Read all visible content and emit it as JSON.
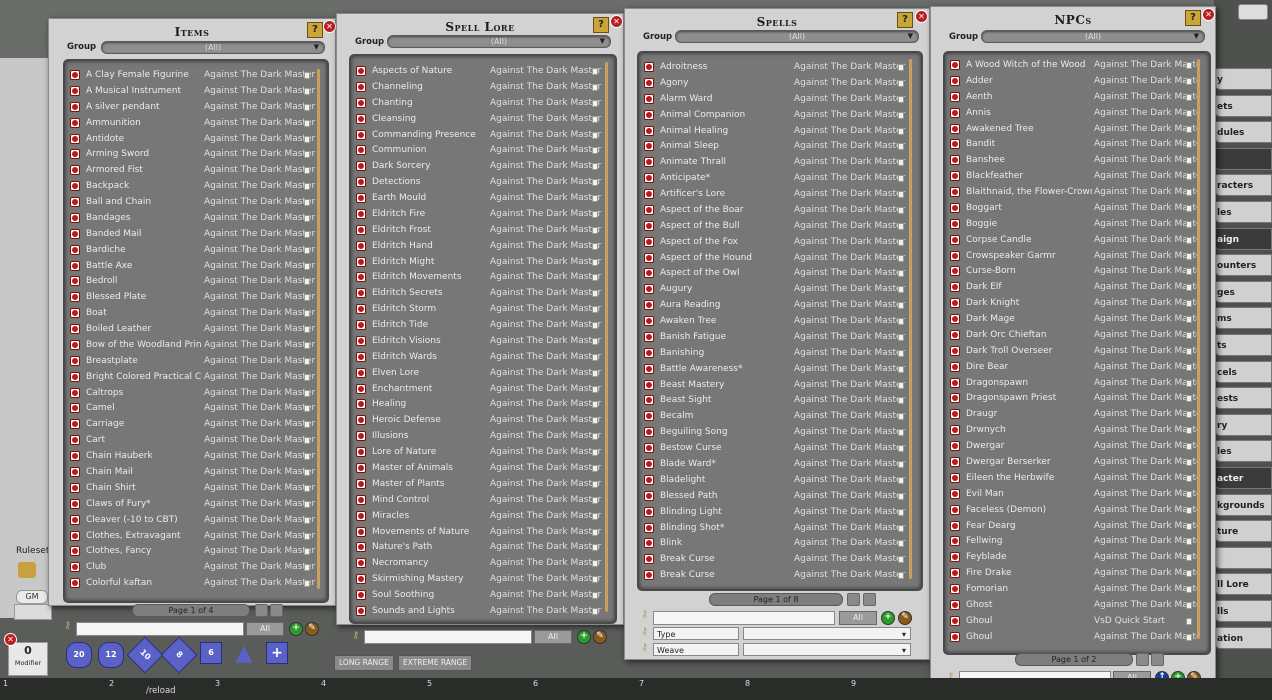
{
  "windows": {
    "items": {
      "title": "Items",
      "group_label": "Group",
      "group_value": "(All)",
      "rows": [
        [
          "A Clay Female Figurine",
          "Against The Dark Master"
        ],
        [
          "A Musical Instrument",
          "Against The Dark Master"
        ],
        [
          "A silver pendant",
          "Against The Dark Master"
        ],
        [
          "Ammunition",
          "Against The Dark Master"
        ],
        [
          "Antidote",
          "Against The Dark Master"
        ],
        [
          "Arming Sword",
          "Against The Dark Master"
        ],
        [
          "Armored Fist",
          "Against The Dark Master"
        ],
        [
          "Backpack",
          "Against The Dark Master"
        ],
        [
          "Ball and Chain",
          "Against The Dark Master"
        ],
        [
          "Bandages",
          "Against The Dark Master"
        ],
        [
          "Banded Mail",
          "Against The Dark Master"
        ],
        [
          "Bardiche",
          "Against The Dark Master"
        ],
        [
          "Battle Axe",
          "Against The Dark Master"
        ],
        [
          "Bedroll",
          "Against The Dark Master"
        ],
        [
          "Blessed Plate",
          "Against The Dark Master"
        ],
        [
          "Boat",
          "Against The Dark Master"
        ],
        [
          "Boiled Leather",
          "Against The Dark Master"
        ],
        [
          "Bow of the Woodland Prince",
          "Against The Dark Master"
        ],
        [
          "Breastplate",
          "Against The Dark Master"
        ],
        [
          "Bright Colored Practical Clothing",
          "Against The Dark Master"
        ],
        [
          "Caltrops",
          "Against The Dark Master"
        ],
        [
          "Camel",
          "Against The Dark Master"
        ],
        [
          "Carriage",
          "Against The Dark Master"
        ],
        [
          "Cart",
          "Against The Dark Master"
        ],
        [
          "Chain Hauberk",
          "Against The Dark Master"
        ],
        [
          "Chain Mail",
          "Against The Dark Master"
        ],
        [
          "Chain Shirt",
          "Against The Dark Master"
        ],
        [
          "Claws of Fury*",
          "Against The Dark Master"
        ],
        [
          "Cleaver (-10 to CBT)",
          "Against The Dark Master"
        ],
        [
          "Clothes, Extravagant",
          "Against The Dark Master"
        ],
        [
          "Clothes, Fancy",
          "Against The Dark Master"
        ],
        [
          "Club",
          "Against The Dark Master"
        ],
        [
          "Colorful kaftan",
          "Against The Dark Master"
        ]
      ],
      "pager": "Page 1 of 4",
      "all_label": "All"
    },
    "spell_lore": {
      "title": "Spell Lore",
      "group_label": "Group",
      "group_value": "(All)",
      "rows": [
        [
          "Aspects of Nature",
          "Against The Dark Master"
        ],
        [
          "Channeling",
          "Against The Dark Master"
        ],
        [
          "Chanting",
          "Against The Dark Master"
        ],
        [
          "Cleansing",
          "Against The Dark Master"
        ],
        [
          "Commanding Presence",
          "Against The Dark Master"
        ],
        [
          "Communion",
          "Against The Dark Master"
        ],
        [
          "Dark Sorcery",
          "Against The Dark Master"
        ],
        [
          "Detections",
          "Against The Dark Master"
        ],
        [
          "Earth Mould",
          "Against The Dark Master"
        ],
        [
          "Eldritch Fire",
          "Against The Dark Master"
        ],
        [
          "Eldritch Frost",
          "Against The Dark Master"
        ],
        [
          "Eldritch Hand",
          "Against The Dark Master"
        ],
        [
          "Eldritch Might",
          "Against The Dark Master"
        ],
        [
          "Eldritch Movements",
          "Against The Dark Master"
        ],
        [
          "Eldritch Secrets",
          "Against The Dark Master"
        ],
        [
          "Eldritch Storm",
          "Against The Dark Master"
        ],
        [
          "Eldritch Tide",
          "Against The Dark Master"
        ],
        [
          "Eldritch Visions",
          "Against The Dark Master"
        ],
        [
          "Eldritch Wards",
          "Against The Dark Master"
        ],
        [
          "Elven Lore",
          "Against The Dark Master"
        ],
        [
          "Enchantment",
          "Against The Dark Master"
        ],
        [
          "Healing",
          "Against The Dark Master"
        ],
        [
          "Heroic Defense",
          "Against The Dark Master"
        ],
        [
          "Illusions",
          "Against The Dark Master"
        ],
        [
          "Lore of Nature",
          "Against The Dark Master"
        ],
        [
          "Master of Animals",
          "Against The Dark Master"
        ],
        [
          "Master of Plants",
          "Against The Dark Master"
        ],
        [
          "Mind Control",
          "Against The Dark Master"
        ],
        [
          "Miracles",
          "Against The Dark Master"
        ],
        [
          "Movements of Nature",
          "Against The Dark Master"
        ],
        [
          "Nature's Path",
          "Against The Dark Master"
        ],
        [
          "Necromancy",
          "Against The Dark Master"
        ],
        [
          "Skirmishing Mastery",
          "Against The Dark Master"
        ],
        [
          "Soul Soothing",
          "Against The Dark Master"
        ],
        [
          "Sounds and Lights",
          "Against The Dark Master"
        ]
      ],
      "all_label": "All"
    },
    "spells": {
      "title": "Spells",
      "group_label": "Group",
      "group_value": "(All)",
      "rows": [
        [
          "Adroitness",
          "Against The Dark Master"
        ],
        [
          "Agony",
          "Against The Dark Master"
        ],
        [
          "Alarm Ward",
          "Against The Dark Master"
        ],
        [
          "Animal Companion",
          "Against The Dark Master"
        ],
        [
          "Animal Healing",
          "Against The Dark Master"
        ],
        [
          "Animal Sleep",
          "Against The Dark Master"
        ],
        [
          "Animate Thrall",
          "Against The Dark Master"
        ],
        [
          "Anticipate*",
          "Against The Dark Master"
        ],
        [
          "Artificer's Lore",
          "Against The Dark Master"
        ],
        [
          "Aspect of the Boar",
          "Against The Dark Master"
        ],
        [
          "Aspect of the Bull",
          "Against The Dark Master"
        ],
        [
          "Aspect of the Fox",
          "Against The Dark Master"
        ],
        [
          "Aspect of the Hound",
          "Against The Dark Master"
        ],
        [
          "Aspect of the Owl",
          "Against The Dark Master"
        ],
        [
          "Augury",
          "Against The Dark Master"
        ],
        [
          "Aura Reading",
          "Against The Dark Master"
        ],
        [
          "Awaken Tree",
          "Against The Dark Master"
        ],
        [
          "Banish Fatigue",
          "Against The Dark Master"
        ],
        [
          "Banishing",
          "Against The Dark Master"
        ],
        [
          "Battle Awareness*",
          "Against The Dark Master"
        ],
        [
          "Beast Mastery",
          "Against The Dark Master"
        ],
        [
          "Beast Sight",
          "Against The Dark Master"
        ],
        [
          "Becalm",
          "Against The Dark Master"
        ],
        [
          "Beguiling Song",
          "Against The Dark Master"
        ],
        [
          "Bestow Curse",
          "Against The Dark Master"
        ],
        [
          "Blade Ward*",
          "Against The Dark Master"
        ],
        [
          "Bladelight",
          "Against The Dark Master"
        ],
        [
          "Blessed Path",
          "Against The Dark Master"
        ],
        [
          "Blinding Light",
          "Against The Dark Master"
        ],
        [
          "Blinding Shot*",
          "Against The Dark Master"
        ],
        [
          "Blink",
          "Against The Dark Master"
        ],
        [
          "Break Curse",
          "Against The Dark Master"
        ],
        [
          "Break Curse",
          "Against The Dark Master"
        ]
      ],
      "pager": "Page 1 of 8",
      "all_label": "All",
      "filter_type": "Type",
      "filter_weave": "Weave"
    },
    "npcs": {
      "title": "NPCs",
      "group_label": "Group",
      "group_value": "(All)",
      "rows": [
        [
          "A Wood Witch of the Wood",
          "Against The Dark Master"
        ],
        [
          "Adder",
          "Against The Dark Master"
        ],
        [
          "Aenth",
          "Against The Dark Master"
        ],
        [
          "Annis",
          "Against The Dark Master"
        ],
        [
          "Awakened Tree",
          "Against The Dark Master"
        ],
        [
          "Bandit",
          "Against The Dark Master"
        ],
        [
          "Banshee",
          "Against The Dark Master"
        ],
        [
          "Blackfeather",
          "Against The Dark Master"
        ],
        [
          "Blaithnaid, the Flower-Crowned",
          "Against The Dark Master"
        ],
        [
          "Boggart",
          "Against The Dark Master"
        ],
        [
          "Boggie",
          "Against The Dark Master"
        ],
        [
          "Corpse Candle",
          "Against The Dark Master"
        ],
        [
          "Crowspeaker Garmr",
          "Against The Dark Master"
        ],
        [
          "Curse-Born",
          "Against The Dark Master"
        ],
        [
          "Dark Elf",
          "Against The Dark Master"
        ],
        [
          "Dark Knight",
          "Against The Dark Master"
        ],
        [
          "Dark Mage",
          "Against The Dark Master"
        ],
        [
          "Dark Orc Chieftan",
          "Against The Dark Master"
        ],
        [
          "Dark Troll Overseer",
          "Against The Dark Master"
        ],
        [
          "Dire Bear",
          "Against The Dark Master"
        ],
        [
          "Dragonspawn",
          "Against The Dark Master"
        ],
        [
          "Dragonspawn Priest",
          "Against The Dark Master"
        ],
        [
          "Draugr",
          "Against The Dark Master"
        ],
        [
          "Drwnych",
          "Against The Dark Master"
        ],
        [
          "Dwergar",
          "Against The Dark Master"
        ],
        [
          "Dwergar Berserker",
          "Against The Dark Master"
        ],
        [
          "Eileen the Herbwife",
          "Against The Dark Master"
        ],
        [
          "Evil Man",
          "Against The Dark Master"
        ],
        [
          "Faceless (Demon)",
          "Against The Dark Master"
        ],
        [
          "Fear Dearg",
          "Against The Dark Master"
        ],
        [
          "Fellwing",
          "Against The Dark Master"
        ],
        [
          "Feyblade",
          "Against The Dark Master"
        ],
        [
          "Fire Drake",
          "Against The Dark Master"
        ],
        [
          "Fomorian",
          "Against The Dark Master"
        ],
        [
          "Ghost",
          "Against The Dark Master"
        ],
        [
          "Ghoul",
          "VsD Quick Start"
        ],
        [
          "Ghoul",
          "Against The Dark Master"
        ]
      ],
      "pager": "Page 1 of 2",
      "all_label": "All"
    }
  },
  "sidebar": [
    "y",
    "ets",
    "dules",
    "",
    "racters",
    "les",
    "aign",
    "ounters",
    "ges",
    "ms",
    "ts",
    "cels",
    "ests",
    "ry",
    "les",
    "acter",
    "kgrounds",
    "ture",
    "",
    "ll Lore",
    "lls",
    "ation"
  ],
  "sidebar_dark": [
    false,
    false,
    false,
    true,
    false,
    false,
    true,
    false,
    false,
    false,
    false,
    false,
    false,
    false,
    false,
    true,
    false,
    false,
    false,
    false,
    false,
    false
  ],
  "left": {
    "ruleset": "Ruleset [",
    "gm": "GM",
    "modifier_value": "0",
    "modifier_label": "Modifier"
  },
  "dice": [
    "20",
    "12",
    "10",
    "8",
    "6",
    "4",
    "+"
  ],
  "range_buttons": [
    "LONG RANGE",
    "EXTREME RANGE"
  ],
  "hotkeys": [
    "1",
    "2",
    "3",
    "4",
    "5",
    "6",
    "7",
    "8",
    "9"
  ],
  "chat": "/reload"
}
